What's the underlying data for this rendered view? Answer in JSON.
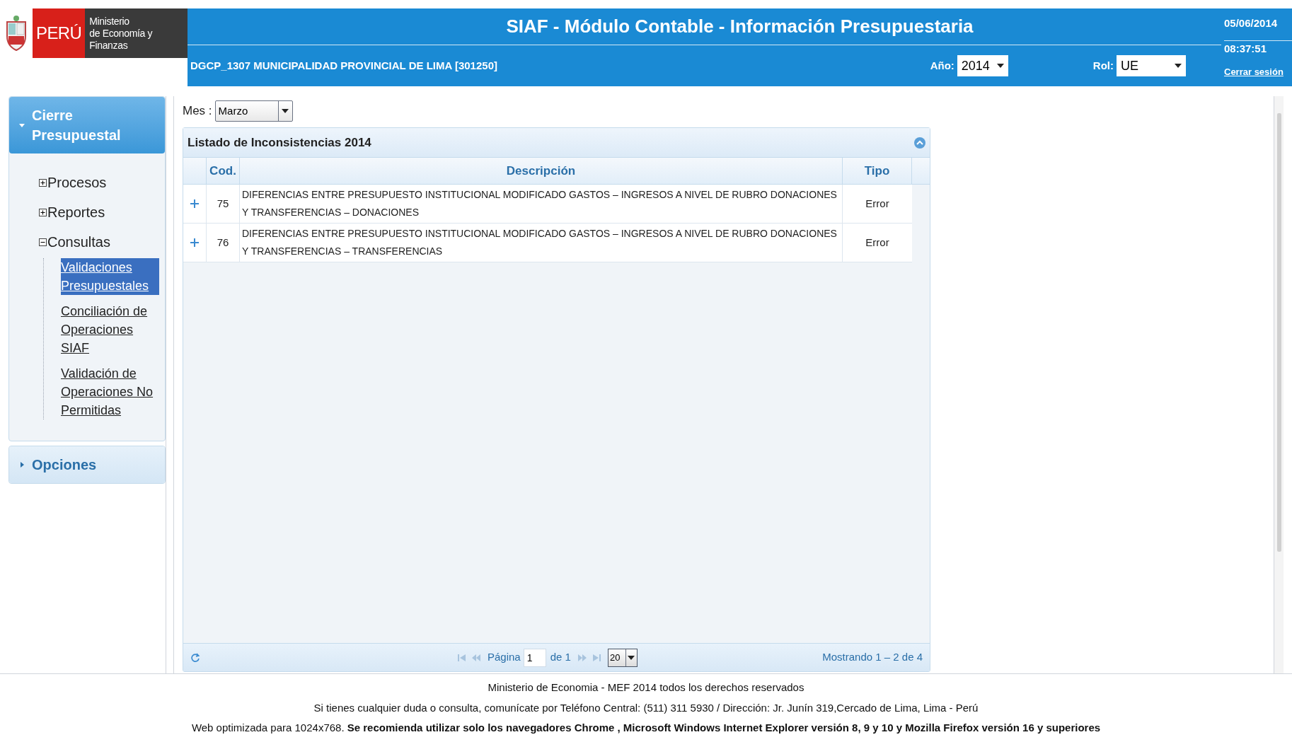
{
  "header": {
    "logo": {
      "country": "PERÚ",
      "ministry_lines": [
        "Ministerio",
        "de Economía y Finanzas"
      ]
    },
    "title": "SIAF - Módulo Contable - Información Presupuestaria",
    "entity": "DGCP_1307  MUNICIPALIDAD PROVINCIAL DE LIMA  [301250]",
    "year_field": {
      "label": "Año:",
      "value": "2014"
    },
    "role_field": {
      "label": "Rol:",
      "value": "UE"
    },
    "date": "05/06/2014",
    "time": "08:37:51",
    "logout": "Cerrar sesión"
  },
  "sidebar": {
    "sections": [
      {
        "title": "Cierre Presupuestal",
        "expanded": true,
        "tree": [
          {
            "label": "Procesos",
            "expanded": false
          },
          {
            "label": "Reportes",
            "expanded": false
          },
          {
            "label": "Consultas",
            "expanded": true,
            "children": [
              {
                "label": "Validaciones Presupuestales",
                "selected": true
              },
              {
                "label": "Conciliación de Operaciones SIAF",
                "selected": false
              },
              {
                "label": "Validación de Operaciones No Permitidas",
                "selected": false
              }
            ]
          }
        ]
      },
      {
        "title": "Opciones",
        "expanded": false
      }
    ]
  },
  "month_filter": {
    "label": "Mes :",
    "value": "Marzo"
  },
  "grid": {
    "title": "Listado de Inconsistencias 2014",
    "columns": [
      "Cod.",
      "Descripción",
      "Tipo"
    ],
    "rows": [
      {
        "cod": "75",
        "description": "DIFERENCIAS ENTRE PRESUPUESTO INSTITUCIONAL MODIFICADO GASTOS – INGRESOS A NIVEL DE RUBRO DONACIONES Y TRANSFERENCIAS – DONACIONES",
        "type": "Error"
      },
      {
        "cod": "76",
        "description": "DIFERENCIAS ENTRE PRESUPUESTO INSTITUCIONAL MODIFICADO GASTOS – INGRESOS A NIVEL DE RUBRO DONACIONES Y TRANSFERENCIAS – TRANSFERENCIAS",
        "type": "Error"
      }
    ],
    "pager": {
      "page_label": "Página",
      "page": "1",
      "of_label": "de 1",
      "page_size": "20",
      "summary": "Mostrando 1 – 2 de 4"
    }
  },
  "footer": [
    "Ministerio de Economia - MEF 2014 todos los derechos reservados",
    "Si tienes cualquier duda o consulta, comunícate por Teléfono Central: (511) 311 5930 / Dirección: Jr. Junín 319,Cercado de Lima, Lima - Perú",
    "Web optimizada para 1024x768. **Se recomienda utilizar solo los navegadores Chrome , Microsoft Windows Internet Explorer versión 8, 9 y 10 y Mozilla Firefox versión 16 y superiores**"
  ]
}
